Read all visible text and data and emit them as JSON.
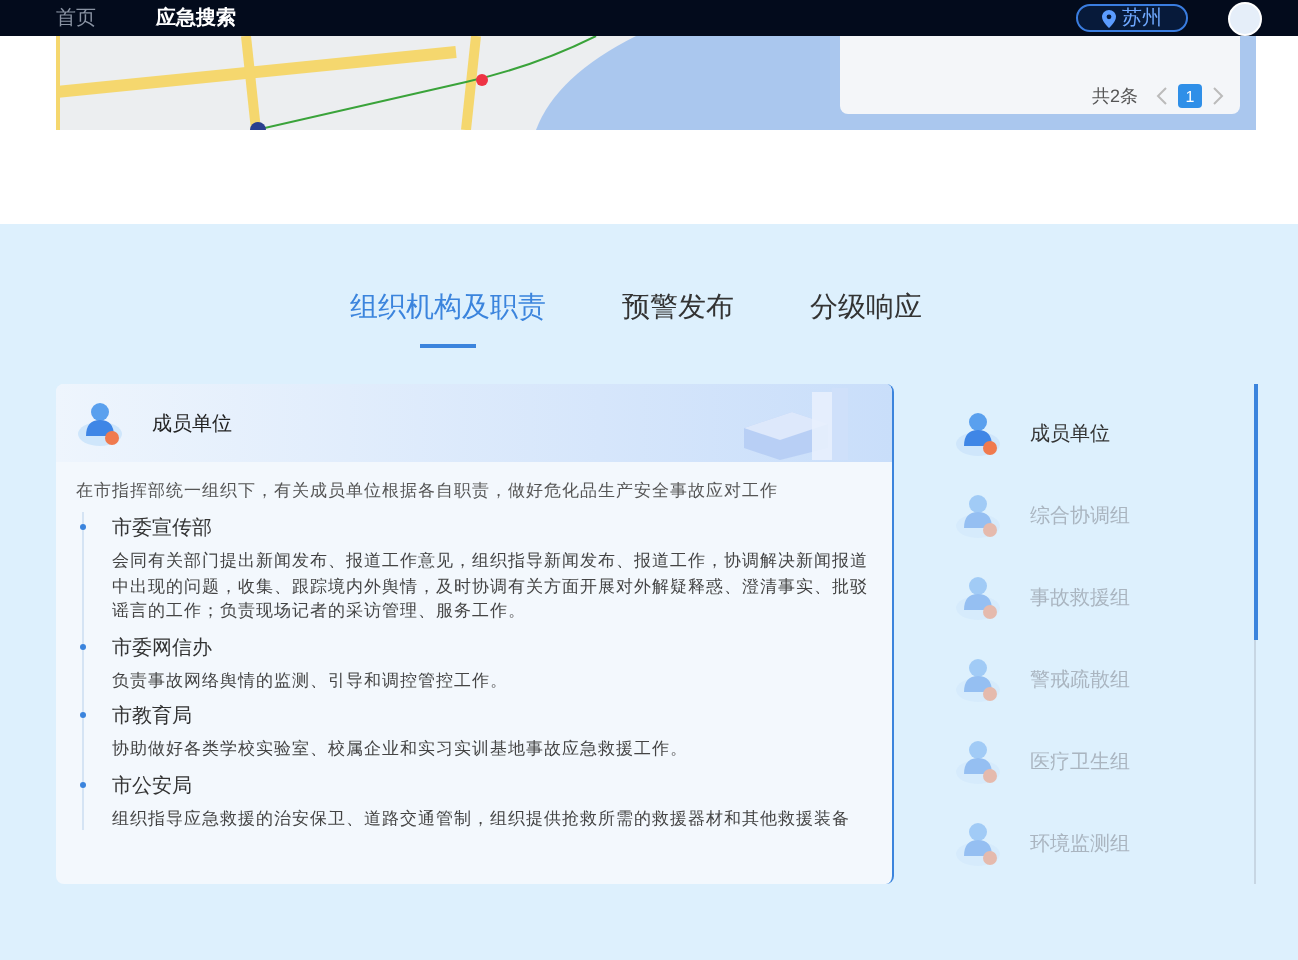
{
  "header": {
    "nav": [
      {
        "label": "首页",
        "selected": false
      },
      {
        "label": "应急搜索",
        "selected": true
      }
    ],
    "location": "苏州"
  },
  "map_panel": {
    "total": "共2条",
    "pages": [
      {
        "label": "1",
        "selected": true
      }
    ]
  },
  "tabs": [
    {
      "label": "组织机构及职责",
      "selected": true
    },
    {
      "label": "预警发布",
      "selected": false
    },
    {
      "label": "分级响应",
      "selected": false
    }
  ],
  "card": {
    "title": "成员单位",
    "intro": "在市指挥部统一组织下，有关成员单位根据各自职责，做好危化品生产安全事故应对工作",
    "units": [
      {
        "name": "市委宣传部",
        "duty": "会同有关部门提出新闻发布、报道工作意见，组织指导新闻发布、报道工作，协调解决新闻报道中出现的问题，收集、跟踪境内外舆情，及时协调有关方面开展对外解疑释惑、澄清事实、批驳谣言的工作；负责现场记者的采访管理、服务工作。"
      },
      {
        "name": "市委网信办",
        "duty": "负责事故网络舆情的监测、引导和调控管控工作。"
      },
      {
        "name": "市教育局",
        "duty": "协助做好各类学校实验室、校属企业和实习实训基地事故应急救援工作。"
      },
      {
        "name": "市公安局",
        "duty": "组织指导应急救援的治安保卫、道路交通管制，组织提供抢救所需的救援器材和其他救援装备"
      }
    ]
  },
  "sidebar": {
    "items": [
      {
        "label": "成员单位",
        "selected": true
      },
      {
        "label": "综合协调组",
        "selected": false
      },
      {
        "label": "事故救援组",
        "selected": false
      },
      {
        "label": "警戒疏散组",
        "selected": false
      },
      {
        "label": "医疗卫生组",
        "selected": false
      },
      {
        "label": "环境监测组",
        "selected": false
      }
    ]
  }
}
